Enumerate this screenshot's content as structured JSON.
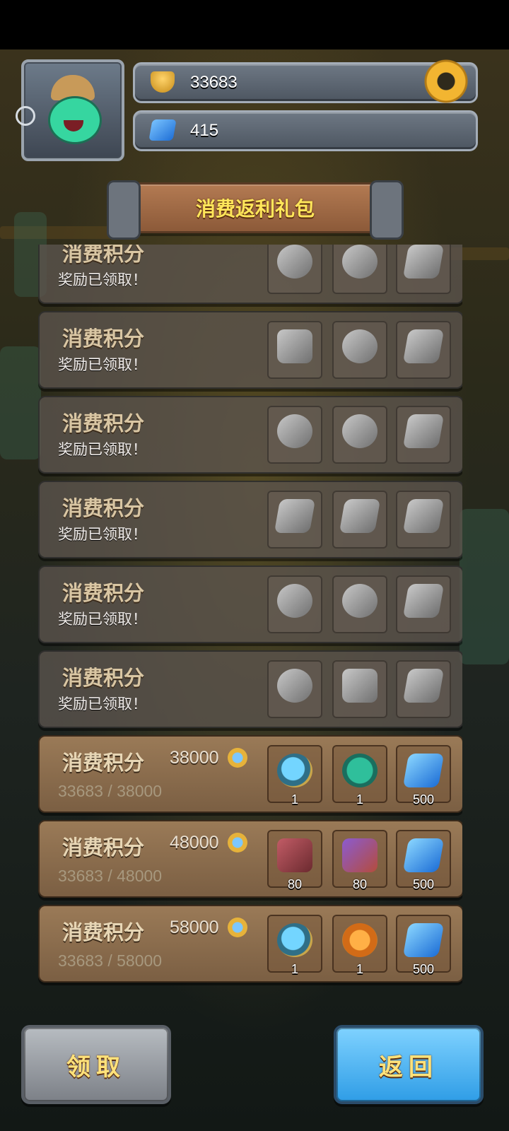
{
  "header": {
    "trophy_value": "33683",
    "gem_value": "415"
  },
  "banner": {
    "title": "消费返利礼包"
  },
  "rewards": [
    {
      "title": "消费积分",
      "status": "奖励已领取！",
      "slots": [
        {
          "art": "hero"
        },
        {
          "art": "crest"
        },
        {
          "art": "gem"
        }
      ]
    },
    {
      "title": "消费积分",
      "status": "奖励已领取！",
      "slots": [
        {
          "art": "book"
        },
        {
          "art": "hero"
        },
        {
          "art": "gem"
        }
      ]
    },
    {
      "title": "消费积分",
      "status": "奖励已领取！",
      "slots": [
        {
          "art": "hero"
        },
        {
          "art": "crest"
        },
        {
          "art": "gem"
        }
      ]
    },
    {
      "title": "消费积分",
      "status": "奖励已领取！",
      "slots": [
        {
          "art": "gem"
        },
        {
          "art": "gem"
        },
        {
          "art": "gem"
        }
      ]
    },
    {
      "title": "消费积分",
      "status": "奖励已领取！",
      "slots": [
        {
          "art": "hero"
        },
        {
          "art": "fire"
        },
        {
          "art": "gem"
        }
      ]
    },
    {
      "title": "消费积分",
      "status": "奖励已领取！",
      "slots": [
        {
          "art": "hero"
        },
        {
          "art": "bag"
        },
        {
          "art": "gem"
        }
      ]
    },
    {
      "title": "消费积分",
      "requirement": "38000",
      "progress": "33683 / 38000",
      "slots": [
        {
          "art": "hero",
          "qty": "1"
        },
        {
          "art": "crest",
          "qty": "1"
        },
        {
          "art": "gem",
          "qty": "500"
        }
      ]
    },
    {
      "title": "消费积分",
      "requirement": "48000",
      "progress": "33683 / 48000",
      "slots": [
        {
          "art": "bag",
          "qty": "80"
        },
        {
          "art": "book",
          "qty": "80"
        },
        {
          "art": "gem",
          "qty": "500"
        }
      ]
    },
    {
      "title": "消费积分",
      "requirement": "58000",
      "progress": "33683 / 58000",
      "slots": [
        {
          "art": "hero",
          "qty": "1"
        },
        {
          "art": "fire",
          "qty": "1"
        },
        {
          "art": "gem",
          "qty": "500"
        }
      ]
    }
  ],
  "buttons": {
    "claim": "领取",
    "back": "返回"
  },
  "colors": {
    "banner_text": "#ffe65a",
    "claim_button": "#9ea3a9",
    "back_button": "#4bb6f5"
  }
}
